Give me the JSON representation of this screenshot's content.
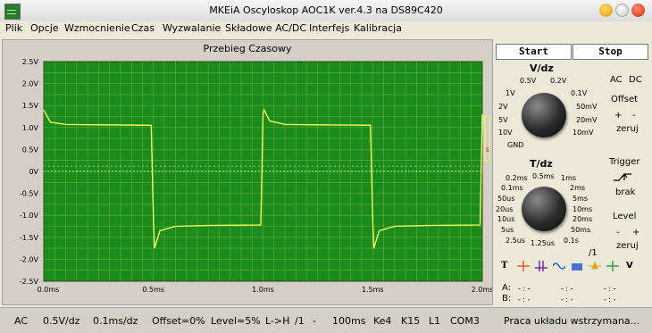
{
  "window": {
    "title": "MKEiA Oscyloskop AOC1K ver.4.3 na DS89C420"
  },
  "menu": [
    "Plik",
    "Opcje",
    "Wzmocnienie",
    "Czas",
    "Wyzwalanie",
    "Składowe AC/DC",
    "Interfejs",
    "Kalibracja"
  ],
  "scope": {
    "title": "Przebieg Czasowy",
    "y_ticks": [
      "2.5V",
      "2.0V",
      "1.5V",
      "1.0V",
      "0.5V",
      "0V",
      "-0.5V",
      "-1.0V",
      "-1.5V",
      "-2.0V",
      "-2.5V"
    ],
    "x_ticks": [
      "0.0ms",
      "0.5ms",
      "1.0ms",
      "1.5ms",
      "2.0ms"
    ],
    "trigger_marker": "E",
    "colors": {
      "background": "#1b8c1b",
      "grid": "#7ab63a",
      "trace": "#ffff66",
      "axis": "#ffffff"
    }
  },
  "chart_data": {
    "type": "line",
    "title": "Przebieg Czasowy",
    "xlabel": "",
    "ylabel": "",
    "x_unit": "ms",
    "xlim": [
      0,
      2.0
    ],
    "ylim": [
      -2.5,
      2.5
    ],
    "grid": true,
    "x": [
      0.0,
      0.03,
      0.1,
      0.25,
      0.49,
      0.5,
      0.505,
      0.53,
      0.6,
      0.75,
      0.99,
      1.0,
      1.005,
      1.03,
      1.1,
      1.25,
      1.49,
      1.5,
      1.505,
      1.53,
      1.6,
      1.75,
      1.99,
      2.0
    ],
    "y": [
      1.4,
      1.12,
      1.07,
      1.06,
      1.05,
      -1.1,
      -1.75,
      -1.35,
      -1.25,
      -1.23,
      -1.22,
      1.3,
      1.4,
      1.15,
      1.07,
      1.06,
      1.05,
      -1.1,
      -1.75,
      -1.35,
      -1.25,
      -1.23,
      -1.22,
      1.3
    ]
  },
  "controls": {
    "start": "Start",
    "stop": "Stop",
    "vdz_title": "V/dz",
    "v_labels": [
      "0.5V",
      "0.2V",
      "1V",
      "0.1V",
      "2V",
      "50mV",
      "5V",
      "20mV",
      "10V",
      "10mV",
      "GND"
    ],
    "ac": "AC",
    "dc": "DC",
    "offset": "Offset",
    "plus": "+",
    "minus": "-",
    "zeruj": "zeruj",
    "tdz_title": "T/dz",
    "t_labels": [
      "0.2ms",
      "0.5ms",
      "1ms",
      "0.1ms",
      "2ms",
      "50us",
      "5ms",
      "20us",
      "10ms",
      "10us",
      "20ms",
      "5us",
      "50ms",
      "2.5us",
      "1.25us",
      "0.1s"
    ],
    "trigger": "Trigger",
    "brak": "brak",
    "level": "Level",
    "level_minus": "-",
    "level_plus": "+",
    "zeruj2": "zeruj",
    "div": "/1",
    "cursor_a": "A:",
    "cursor_b": "B:",
    "cursor_val": "- : -"
  },
  "status": {
    "coupling": "AC",
    "vdiv": "0.5V/dz",
    "tdiv": "0.1ms/dz",
    "offset": "Offset=0%",
    "level": "Level=5%",
    "edge": "L->H",
    "div": "/1",
    "dash": "-",
    "time": "100ms",
    "ke": "Ke4",
    "k": "K15",
    "l": "L1",
    "port": "COM3",
    "message": "Praca układu wstrzymana..."
  }
}
